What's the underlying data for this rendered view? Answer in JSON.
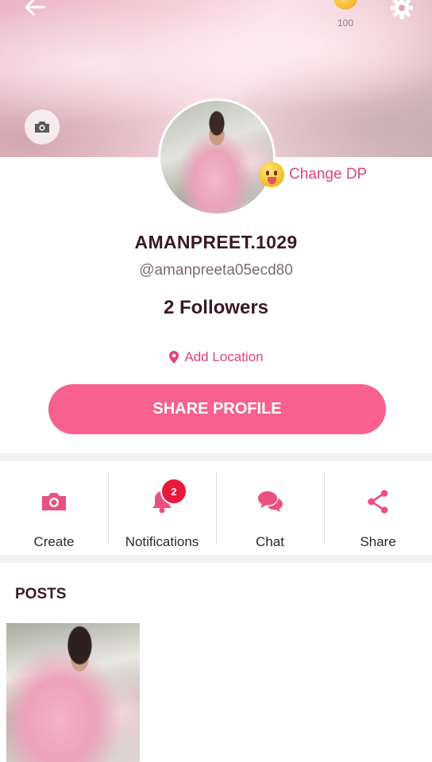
{
  "cover": {
    "coin_count": "100"
  },
  "profile": {
    "change_dp_label": "Change DP",
    "username": "AMANPREET.1029",
    "handle": "@amanpreeta05ecd80",
    "followers": "2 Followers",
    "add_location_label": "Add Location",
    "share_profile_label": "SHARE PROFILE"
  },
  "actions": [
    {
      "label": "Create",
      "icon": "camera-icon"
    },
    {
      "label": "Notifications",
      "icon": "bell-icon",
      "badge": "2"
    },
    {
      "label": "Chat",
      "icon": "chat-bubbles-icon"
    },
    {
      "label": "Share",
      "icon": "share-icon"
    }
  ],
  "posts": {
    "title": "POSTS"
  },
  "colors": {
    "accent": "#f7608f",
    "accent_text": "#e0457a",
    "badge": "#e8193b",
    "title_text": "#3a1a24"
  }
}
